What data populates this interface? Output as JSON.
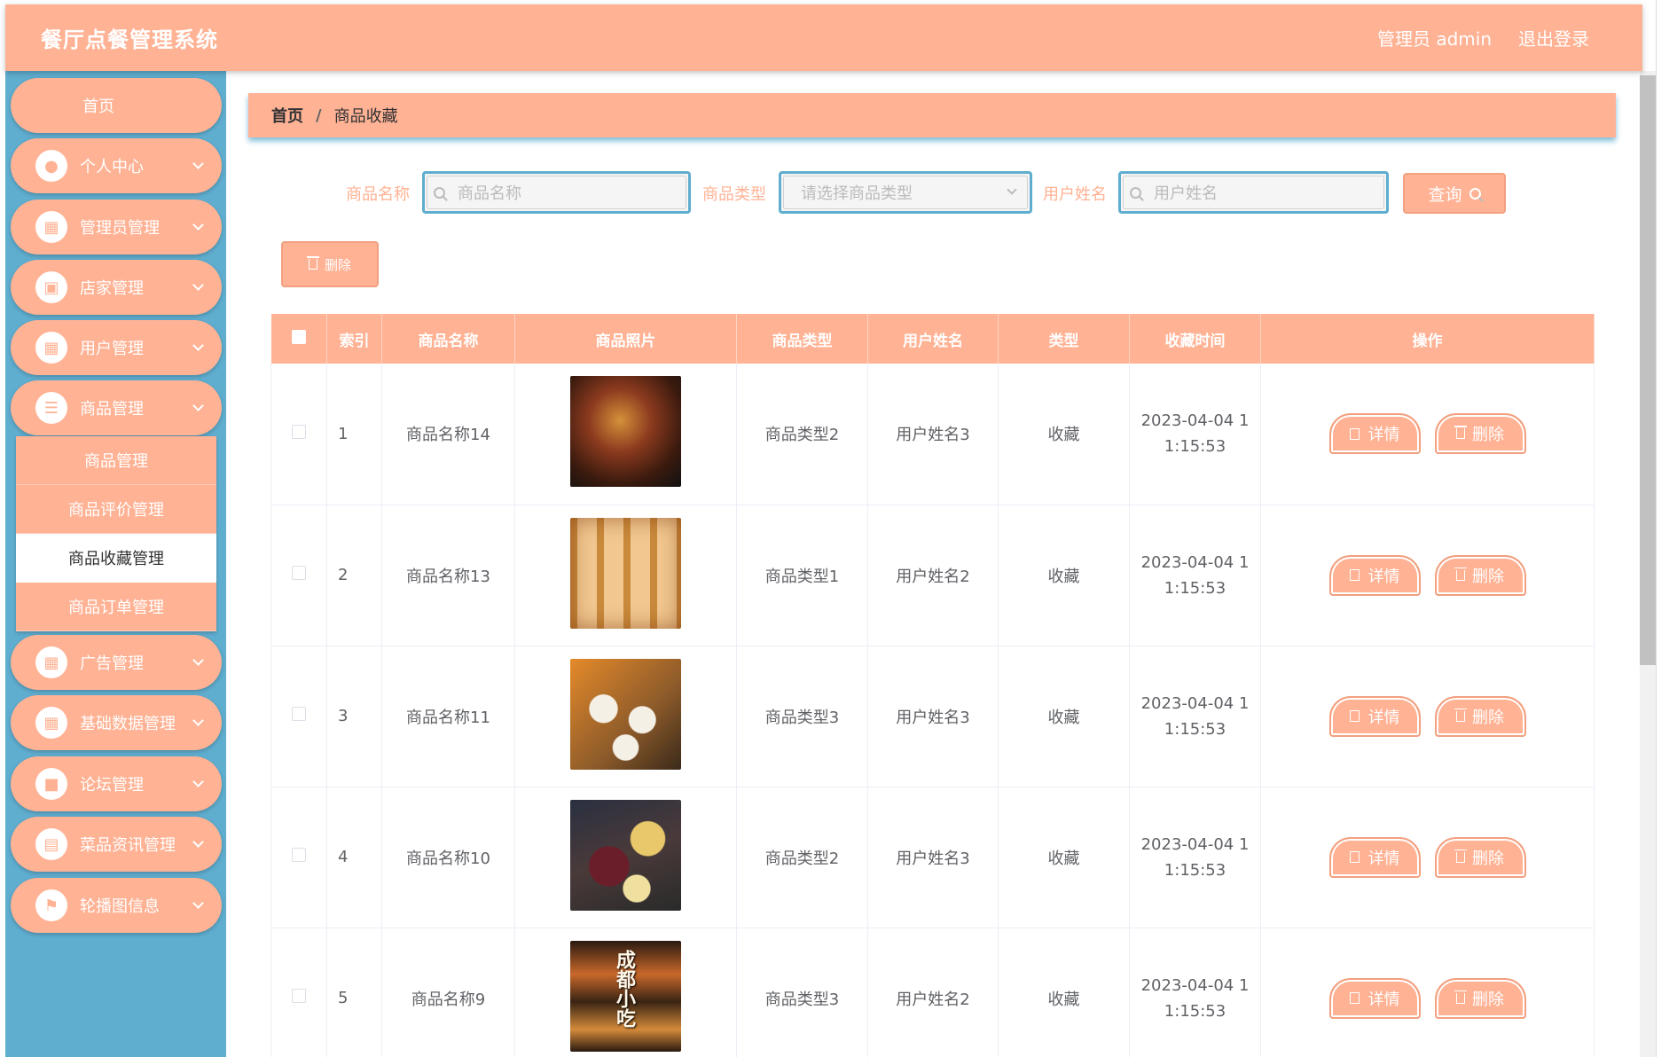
{
  "header": {
    "brand": "餐厅点餐管理系统",
    "admin": "管理员 admin",
    "logout": "退出登录"
  },
  "sidebar": {
    "items": [
      {
        "label": "首页",
        "icon": "home"
      },
      {
        "label": "个人中心",
        "icon": "user-icon"
      },
      {
        "label": "管理员管理",
        "icon": "grid-icon"
      },
      {
        "label": "店家管理",
        "icon": "clipboard-icon"
      },
      {
        "label": "用户管理",
        "icon": "grid-icon"
      },
      {
        "label": "商品管理",
        "icon": "list-icon"
      },
      {
        "label": "广告管理",
        "icon": "grid-icon"
      },
      {
        "label": "基础数据管理",
        "icon": "grid-icon"
      },
      {
        "label": "论坛管理",
        "icon": "briefcase-icon"
      },
      {
        "label": "菜品资讯管理",
        "icon": "document-icon"
      },
      {
        "label": "轮播图信息",
        "icon": "flag-icon"
      }
    ],
    "submenu": [
      "商品管理",
      "商品评价管理",
      "商品收藏管理",
      "商品订单管理"
    ]
  },
  "breadcrumb": {
    "home": "首页",
    "sep": "/",
    "current": "商品收藏"
  },
  "search": {
    "name_label": "商品名称",
    "name_placeholder": "商品名称",
    "type_label": "商品类型",
    "type_placeholder": "请选择商品类型",
    "user_label": "用户姓名",
    "user_placeholder": "用户姓名",
    "query": "查询",
    "delete": "删除"
  },
  "table": {
    "headers": [
      "索引",
      "商品名称",
      "商品照片",
      "商品类型",
      "用户姓名",
      "类型",
      "收藏时间",
      "操作"
    ],
    "rows": [
      {
        "index": "1",
        "name": "商品名称14",
        "type": "商品类型2",
        "user": "用户姓名3",
        "kind": "收藏",
        "time1": "2023-04-04 1",
        "time2": "1:15:53"
      },
      {
        "index": "2",
        "name": "商品名称13",
        "type": "商品类型1",
        "user": "用户姓名2",
        "kind": "收藏",
        "time1": "2023-04-04 1",
        "time2": "1:15:53"
      },
      {
        "index": "3",
        "name": "商品名称11",
        "type": "商品类型3",
        "user": "用户姓名3",
        "kind": "收藏",
        "time1": "2023-04-04 1",
        "time2": "1:15:53"
      },
      {
        "index": "4",
        "name": "商品名称10",
        "type": "商品类型2",
        "user": "用户姓名3",
        "kind": "收藏",
        "time1": "2023-04-04 1",
        "time2": "1:15:53"
      },
      {
        "index": "5",
        "name": "商品名称9",
        "type": "商品类型3",
        "user": "用户姓名2",
        "kind": "收藏",
        "time1": "2023-04-04 1",
        "time2": "1:15:53"
      }
    ],
    "detail": "详情",
    "delete": "删除",
    "photo5_text": "成都小吃"
  },
  "colors": {
    "accent": "#ffb294",
    "sidebar": "#5fadcf"
  }
}
